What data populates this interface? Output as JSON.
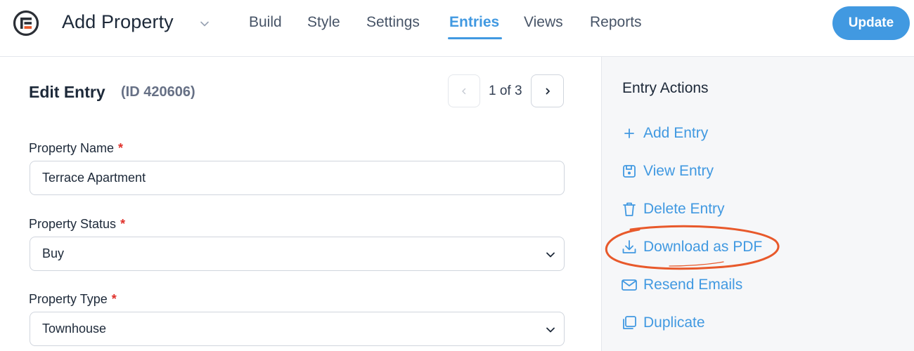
{
  "header": {
    "form_title": "Add Property",
    "tabs": [
      {
        "label": "Build"
      },
      {
        "label": "Style"
      },
      {
        "label": "Settings"
      },
      {
        "label": "Entries",
        "active": true
      },
      {
        "label": "Views"
      },
      {
        "label": "Reports"
      }
    ],
    "update_label": "Update"
  },
  "entry": {
    "title": "Edit Entry",
    "id_label": "(ID 420606)",
    "pager_text": "1 of 3"
  },
  "fields": [
    {
      "label": "Property Name",
      "required": "*",
      "value": "Terrace Apartment",
      "type": "text"
    },
    {
      "label": "Property Status",
      "required": "*",
      "value": "Buy",
      "type": "select"
    },
    {
      "label": "Property Type",
      "required": "*",
      "value": "Townhouse",
      "type": "select"
    }
  ],
  "sidebar": {
    "title": "Entry Actions",
    "actions": [
      {
        "label": "Add Entry",
        "icon": "plus-icon"
      },
      {
        "label": "View Entry",
        "icon": "save-icon"
      },
      {
        "label": "Delete Entry",
        "icon": "trash-icon"
      },
      {
        "label": "Download as PDF",
        "icon": "download-icon"
      },
      {
        "label": "Resend Emails",
        "icon": "envelope-icon"
      },
      {
        "label": "Duplicate",
        "icon": "duplicate-icon"
      }
    ]
  },
  "colors": {
    "accent": "#4199e1",
    "required": "#e0312b",
    "annotation": "#e8592b",
    "sidebar_bg": "#f6f7f9"
  }
}
